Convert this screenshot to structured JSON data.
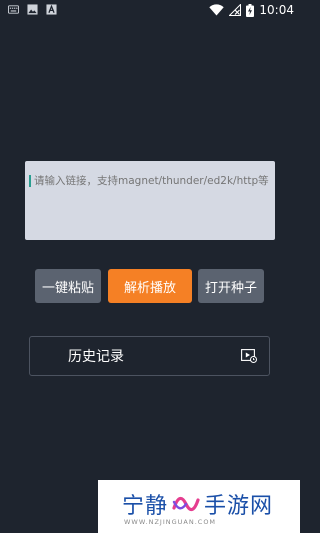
{
  "status_bar": {
    "time": "10:04",
    "left_icons": [
      "keyboard-icon",
      "image-icon",
      "a-icon"
    ],
    "right_icons": [
      "wifi-icon",
      "signal-off-icon",
      "battery-charging-icon"
    ]
  },
  "input": {
    "value": "",
    "placeholder": "请输入链接，支持magnet/thunder/ed2k/http等"
  },
  "buttons": {
    "paste": "一键粘贴",
    "play": "解析播放",
    "torrent": "打开种子"
  },
  "history": {
    "label": "历史记录",
    "icon": "history-video-icon"
  },
  "watermark": {
    "left": "宁静",
    "right": "手游网",
    "url": "WWW.NZJINGUAN.COM"
  },
  "colors": {
    "background": "#1e242e",
    "accent": "#f58025",
    "secondary_button": "#5b6370",
    "input_bg": "#d5d9e3"
  }
}
